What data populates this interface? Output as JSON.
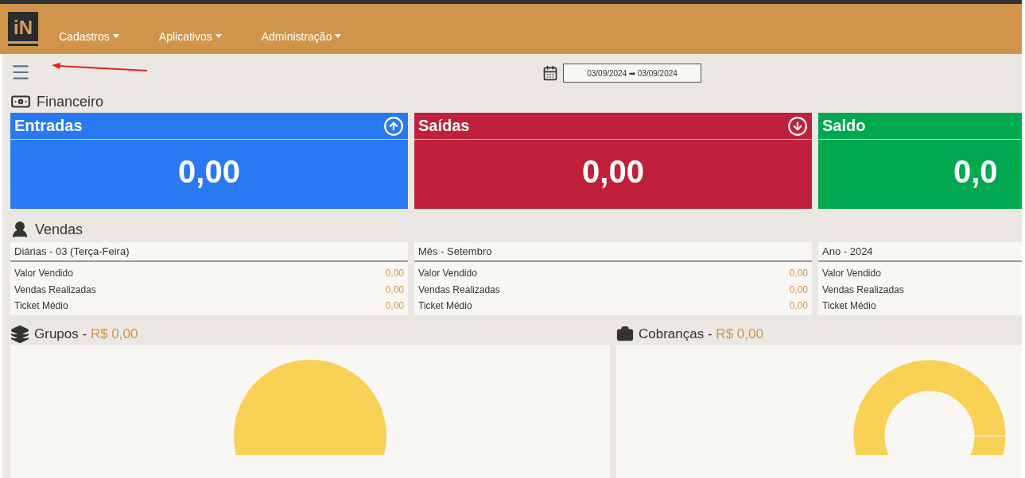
{
  "header": {
    "logo": "iN",
    "nav": [
      {
        "label": "Cadastros"
      },
      {
        "label": "Aplicativos"
      },
      {
        "label": "Administração"
      }
    ]
  },
  "toolbar": {
    "date_range": "03/09/2024 ➡ 03/09/2024"
  },
  "financeiro": {
    "title": "Financeiro",
    "cards": [
      {
        "title": "Entradas",
        "value": "0,00",
        "kind": "in",
        "color": "#2979f3"
      },
      {
        "title": "Saídas",
        "value": "0,00",
        "kind": "out",
        "color": "#c0203b"
      },
      {
        "title": "Saldo",
        "value": "0,0",
        "kind": "balance",
        "color": "#00a84f"
      }
    ]
  },
  "vendas": {
    "title": "Vendas",
    "panels": [
      {
        "title": "Diárias - 03 (Terça-Feira)",
        "rows": [
          {
            "label": "Valor Vendido",
            "value": "0,00"
          },
          {
            "label": "Vendas Realizadas",
            "value": "0,00"
          },
          {
            "label": "Ticket Médio",
            "value": "0,00"
          }
        ]
      },
      {
        "title": "Mês - Setembro",
        "rows": [
          {
            "label": "Valor Vendido",
            "value": "0,00"
          },
          {
            "label": "Vendas Realizadas",
            "value": "0,00"
          },
          {
            "label": "Ticket Médio",
            "value": "0,00"
          }
        ]
      },
      {
        "title": "Ano - 2024",
        "rows": [
          {
            "label": "Valor Vendido"
          },
          {
            "label": "Vendas Realizadas"
          },
          {
            "label": "Ticket Médio"
          }
        ]
      }
    ]
  },
  "charts": [
    {
      "title": "Grupos",
      "separator": "-",
      "amount": "R$ 0,00",
      "kind": "pie"
    },
    {
      "title": "Cobranças",
      "separator": "-",
      "amount": "R$ 0,00",
      "kind": "donut"
    }
  ]
}
